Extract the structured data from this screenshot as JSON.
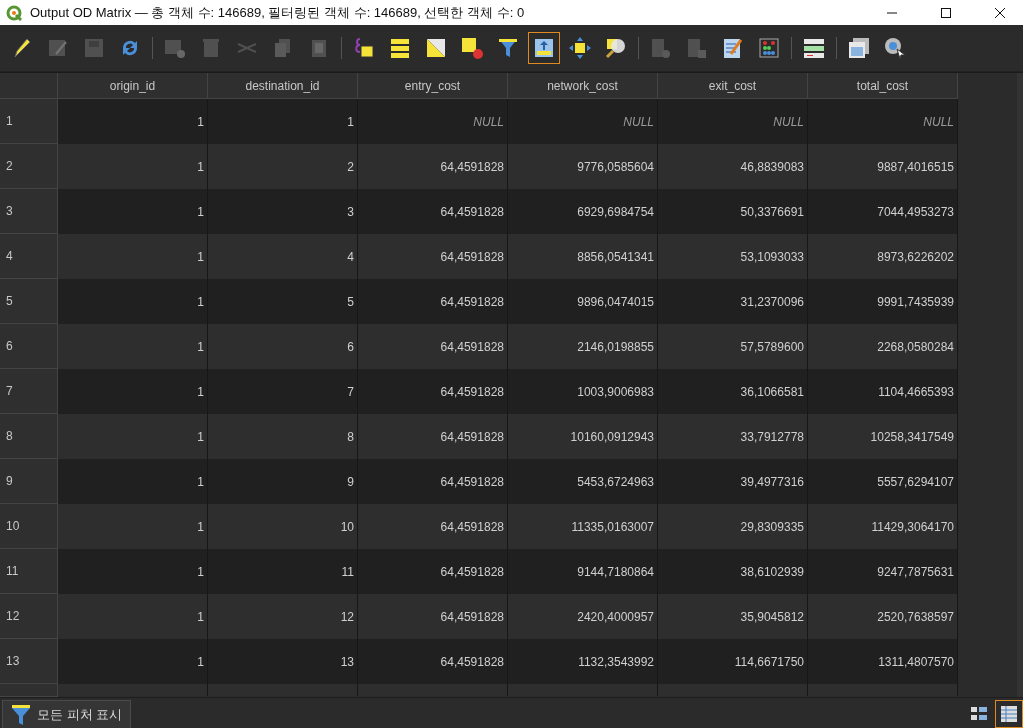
{
  "window": {
    "title": "Output OD Matrix — 총 객체 수: 146689, 필터링된 객체 수: 146689, 선택한 객체 수: 0"
  },
  "toolbar": {
    "groups": [
      [
        {
          "kind": "pencil",
          "disabled": false,
          "selected": false
        },
        {
          "kind": "edit",
          "disabled": true,
          "selected": false
        },
        {
          "kind": "save",
          "disabled": true,
          "selected": false
        },
        {
          "kind": "refresh",
          "disabled": false,
          "selected": false
        }
      ],
      [
        {
          "kind": "add-row",
          "disabled": true,
          "selected": false
        },
        {
          "kind": "trash",
          "disabled": true,
          "selected": false
        },
        {
          "kind": "scissors",
          "disabled": true,
          "selected": false
        },
        {
          "kind": "copy",
          "disabled": true,
          "selected": false
        },
        {
          "kind": "paste",
          "disabled": true,
          "selected": false
        }
      ],
      [
        {
          "kind": "expression",
          "disabled": false,
          "selected": false
        },
        {
          "kind": "select-all",
          "disabled": false,
          "selected": false
        },
        {
          "kind": "invert",
          "disabled": false,
          "selected": false
        },
        {
          "kind": "deselect",
          "disabled": false,
          "selected": false
        },
        {
          "kind": "filter",
          "disabled": false,
          "selected": false
        },
        {
          "kind": "move-top",
          "disabled": false,
          "selected": true
        },
        {
          "kind": "pan",
          "disabled": false,
          "selected": false
        },
        {
          "kind": "zoom",
          "disabled": false,
          "selected": false
        }
      ],
      [
        {
          "kind": "new-field",
          "disabled": true,
          "selected": false
        },
        {
          "kind": "delete-field",
          "disabled": true,
          "selected": false
        },
        {
          "kind": "field-calc",
          "disabled": false,
          "selected": false
        },
        {
          "kind": "conditional",
          "disabled": false,
          "selected": false
        }
      ],
      [
        {
          "kind": "dock",
          "disabled": false,
          "selected": false
        }
      ],
      [
        {
          "kind": "table",
          "disabled": false,
          "selected": false
        },
        {
          "kind": "gear",
          "disabled": false,
          "selected": false
        }
      ]
    ]
  },
  "table": {
    "columns": [
      "origin_id",
      "destination_id",
      "entry_cost",
      "network_cost",
      "exit_cost",
      "total_cost"
    ],
    "rows": [
      {
        "number": "1",
        "cells": [
          "1",
          "1",
          {
            "kind": "null",
            "text": "NULL"
          },
          {
            "kind": "null",
            "text": "NULL"
          },
          {
            "kind": "null",
            "text": "NULL"
          },
          {
            "kind": "null",
            "text": "NULL"
          }
        ]
      },
      {
        "number": "2",
        "cells": [
          "1",
          "2",
          "64,4591828",
          "9776,0585604",
          "46,8839083",
          "9887,4016515"
        ]
      },
      {
        "number": "3",
        "cells": [
          "1",
          "3",
          "64,4591828",
          "6929,6984754",
          "50,3376691",
          "7044,4953273"
        ]
      },
      {
        "number": "4",
        "cells": [
          "1",
          "4",
          "64,4591828",
          "8856,0541341",
          "53,1093033",
          "8973,6226202"
        ]
      },
      {
        "number": "5",
        "cells": [
          "1",
          "5",
          "64,4591828",
          "9896,0474015",
          "31,2370096",
          "9991,7435939"
        ]
      },
      {
        "number": "6",
        "cells": [
          "1",
          "6",
          "64,4591828",
          "2146,0198855",
          "57,5789600",
          "2268,0580284"
        ]
      },
      {
        "number": "7",
        "cells": [
          "1",
          "7",
          "64,4591828",
          "1003,9006983",
          "36,1066581",
          "1104,4665393"
        ]
      },
      {
        "number": "8",
        "cells": [
          "1",
          "8",
          "64,4591828",
          "10160,0912943",
          "33,7912778",
          "10258,3417549"
        ]
      },
      {
        "number": "9",
        "cells": [
          "1",
          "9",
          "64,4591828",
          "5453,6724963",
          "39,4977316",
          "5557,6294107"
        ]
      },
      {
        "number": "10",
        "cells": [
          "1",
          "10",
          "64,4591828",
          "11335,0163007",
          "29,8309335",
          "11429,3064170"
        ]
      },
      {
        "number": "11",
        "cells": [
          "1",
          "11",
          "64,4591828",
          "9144,7180864",
          "38,6102939",
          "9247,7875631"
        ]
      },
      {
        "number": "12",
        "cells": [
          "1",
          "12",
          "64,4591828",
          "2420,4000957",
          "35,9045812",
          "2520,7638597"
        ]
      },
      {
        "number": "13",
        "cells": [
          "1",
          "13",
          "64,4591828",
          "1132,3543992",
          "114,6671750",
          "1311,4807570"
        ]
      }
    ]
  },
  "bottom_bar": {
    "filter_button": "모든 피처 표시",
    "views": [
      {
        "kind": "form",
        "selected": false
      },
      {
        "kind": "table",
        "selected": true
      }
    ]
  }
}
